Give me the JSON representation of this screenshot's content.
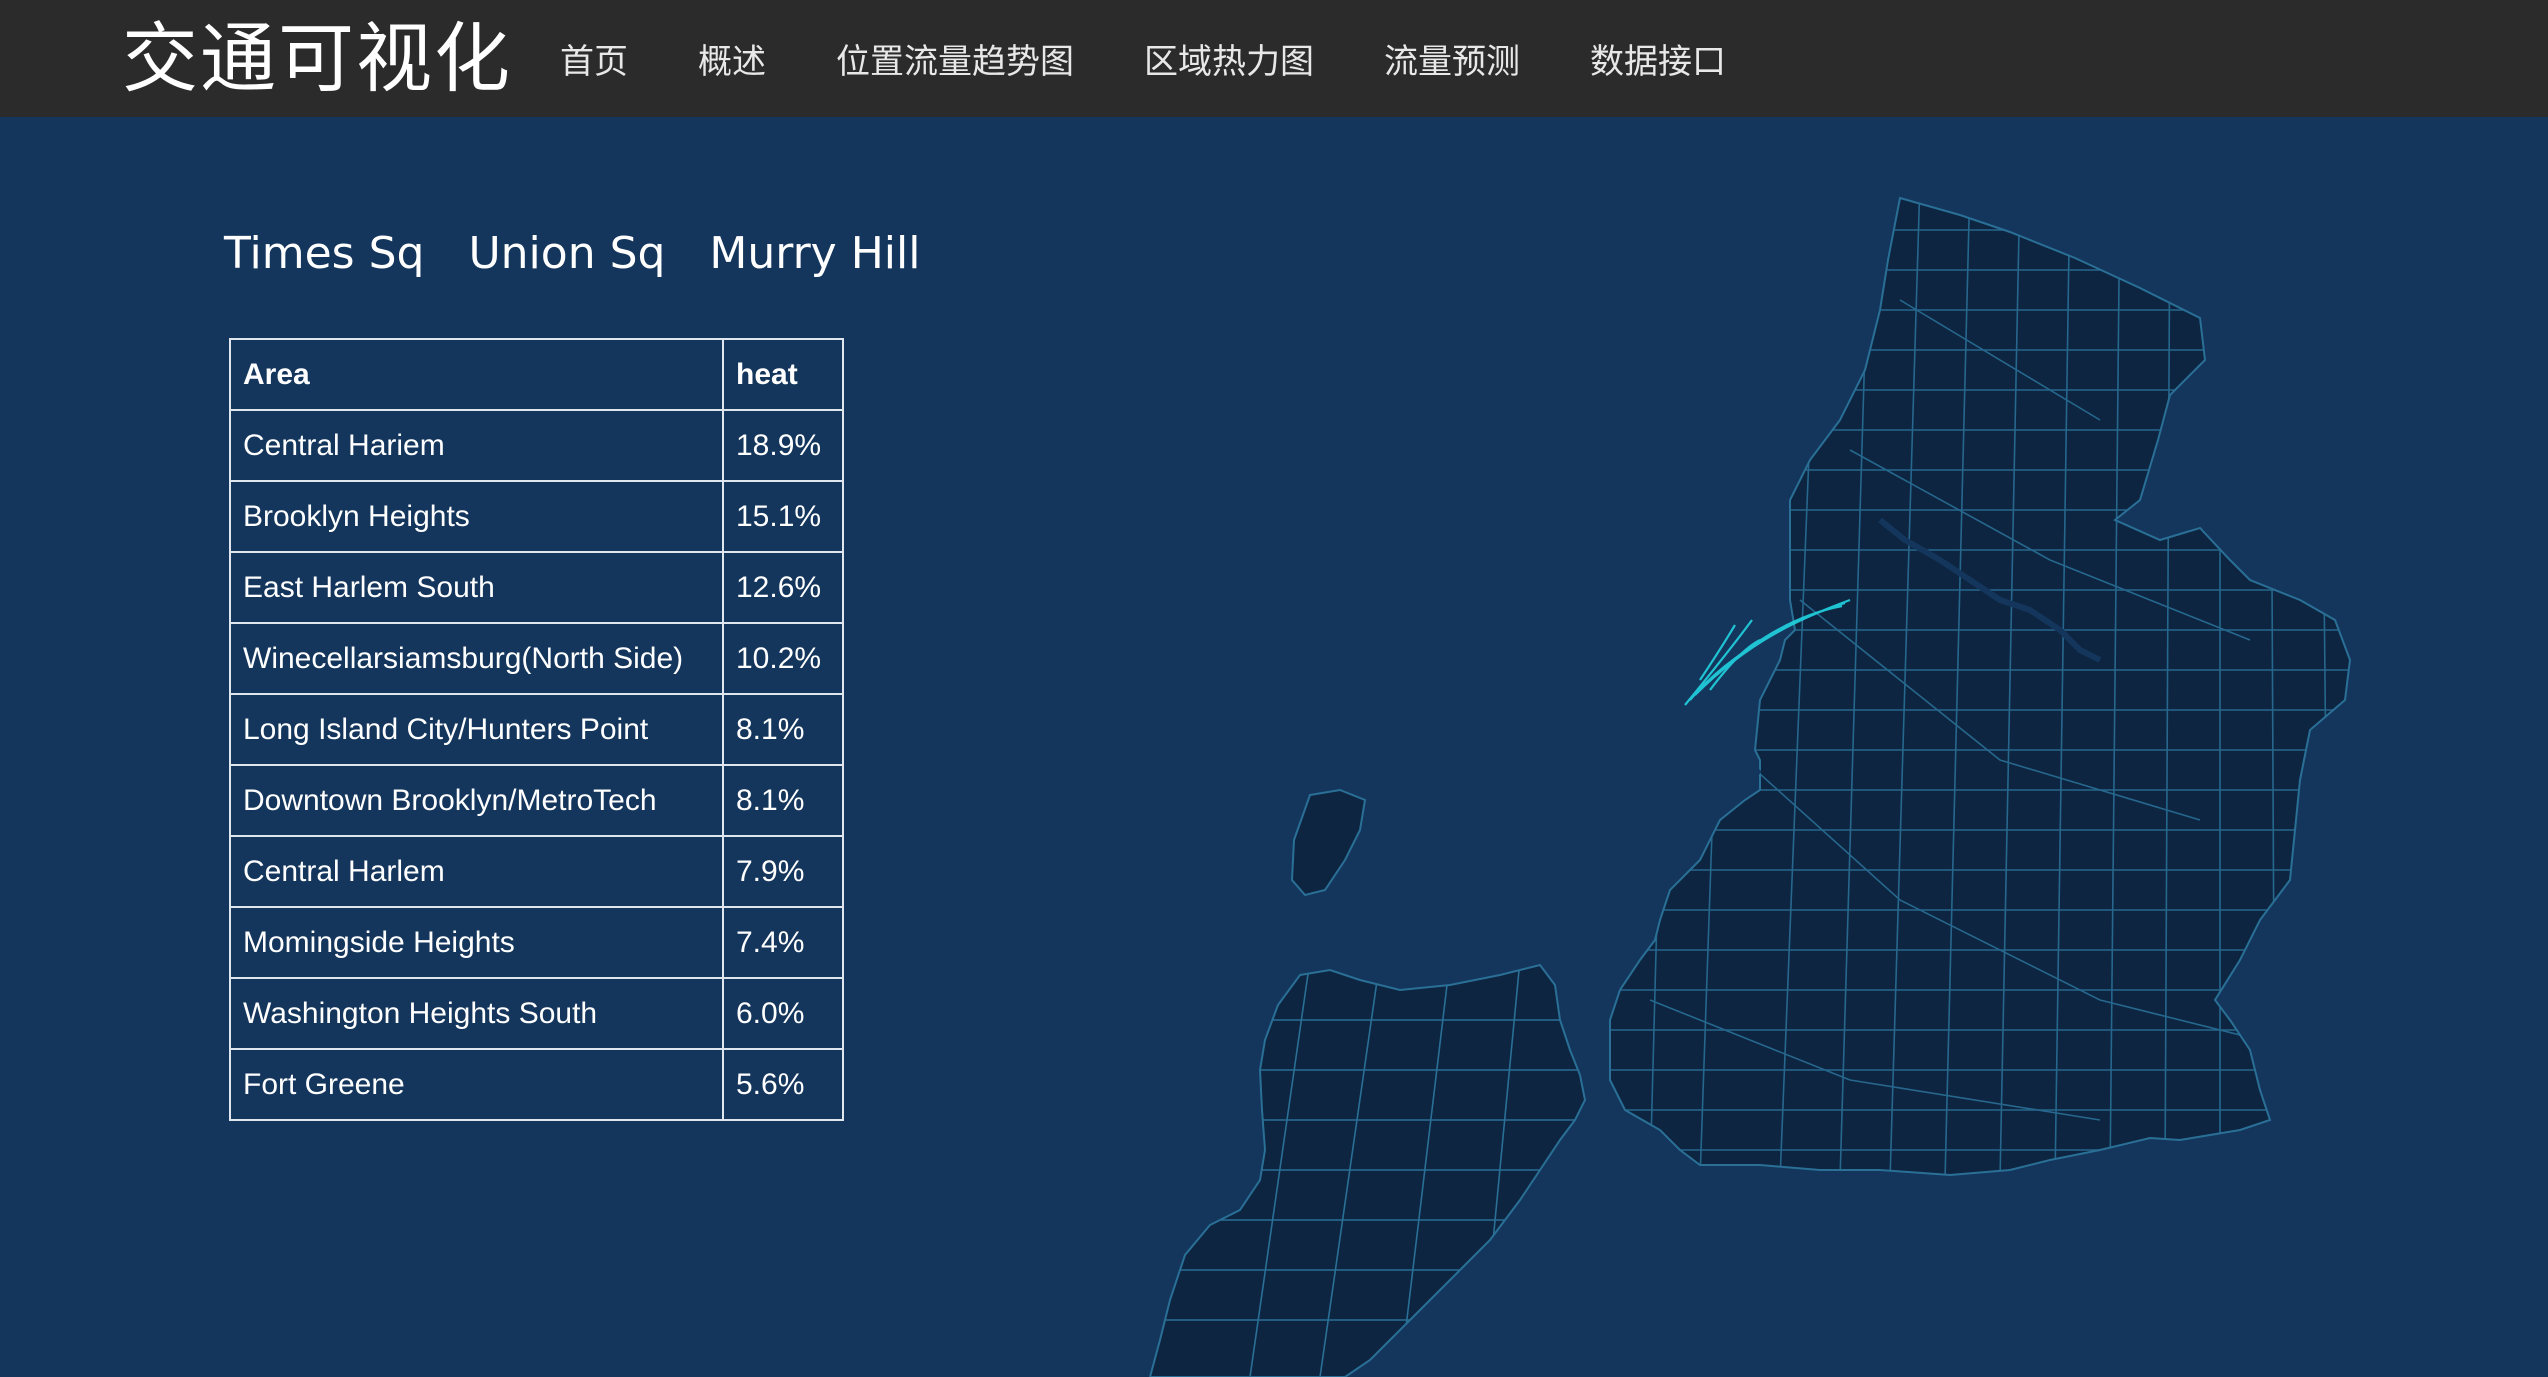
{
  "app": {
    "title": "交通可视化"
  },
  "nav": {
    "items": [
      "首页",
      "概述",
      "位置流量趋势图",
      "区域热力图",
      "流量预测",
      "数据接口"
    ]
  },
  "tabs": [
    "Times Sq",
    "Union Sq",
    "Murry Hill"
  ],
  "table": {
    "headers": {
      "area": "Area",
      "heat": "heat"
    },
    "rows": [
      {
        "area": "Central Hariem",
        "heat": "18.9%"
      },
      {
        "area": "Brooklyn Heights",
        "heat": "15.1%"
      },
      {
        "area": "East Harlem South",
        "heat": "12.6%"
      },
      {
        "area": "Winecellarsiamsburg(North Side)",
        "heat": "10.2%"
      },
      {
        "area": "Long Island City/Hunters Point",
        "heat": "8.1%"
      },
      {
        "area": "Downtown Brooklyn/MetroTech",
        "heat": "8.1%"
      },
      {
        "area": "Central Harlem",
        "heat": "7.9%"
      },
      {
        "area": "Momingside Heights",
        "heat": "7.4%"
      },
      {
        "area": "Washington Heights South",
        "heat": "6.0%"
      },
      {
        "area": "Fort Greene",
        "heat": "5.6%"
      }
    ]
  },
  "map": {
    "region_fill": "#0d2540",
    "border_color": "#2a6f96",
    "flow_color": "#22d3e0"
  }
}
